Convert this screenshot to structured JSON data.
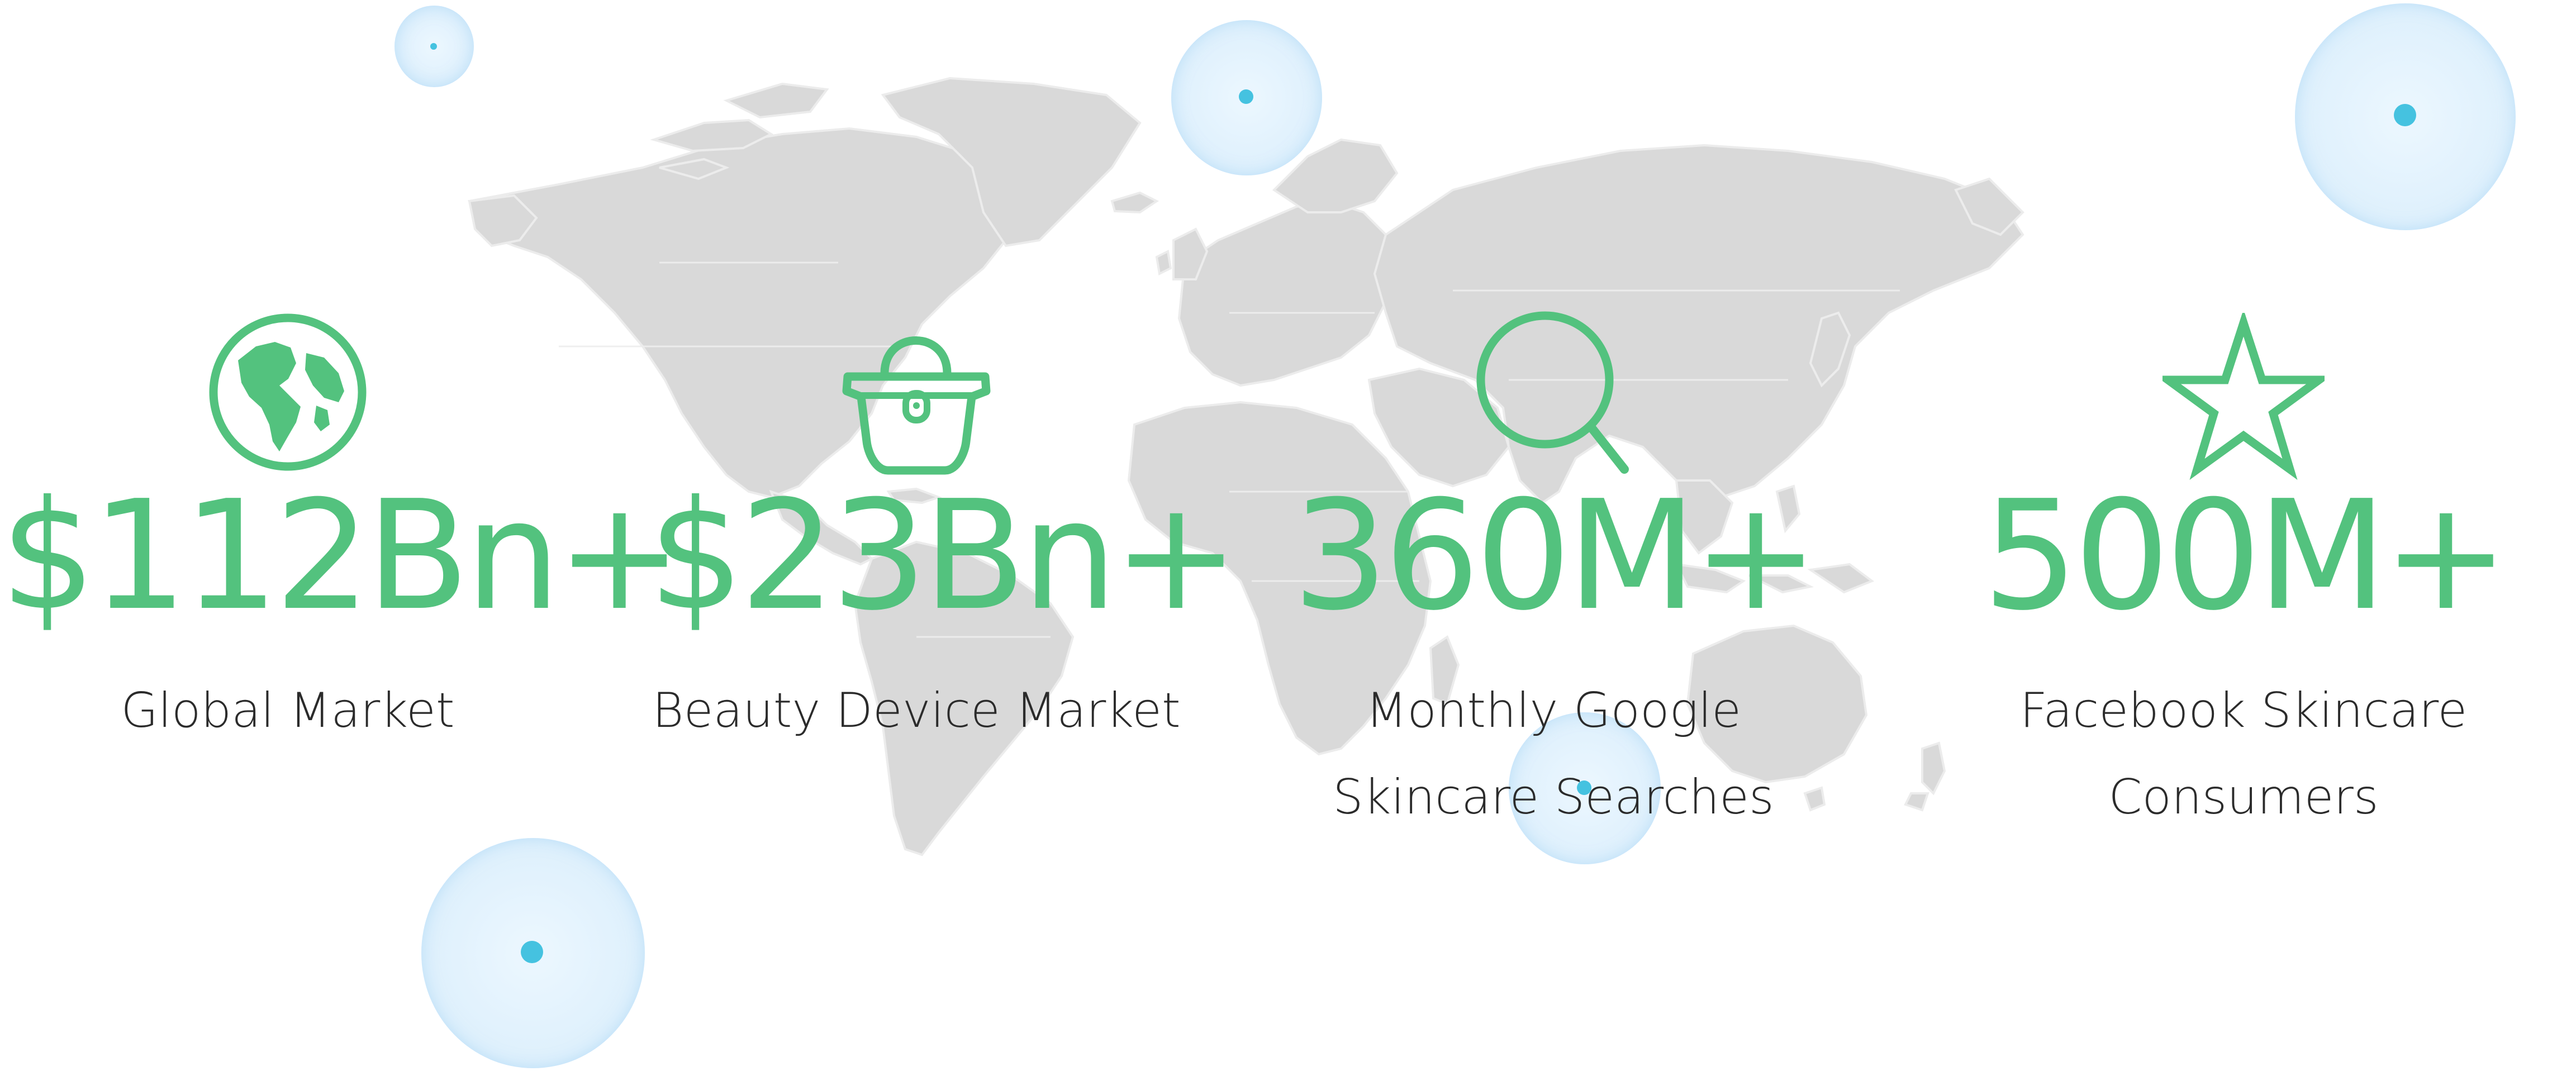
{
  "stats": [
    {
      "value": "$112Bn+",
      "label": "Global Market",
      "icon": "globe-icon"
    },
    {
      "value": "$23Bn+",
      "label": "Beauty Device Market",
      "icon": "handbag-icon"
    },
    {
      "value": "360M+",
      "label": "Monthly Google Skincare Searches",
      "icon": "magnifier-icon"
    },
    {
      "value": "500M+",
      "label": "Facebook Skincare Consumers",
      "icon": "star-icon"
    }
  ],
  "colors": {
    "accent": "#53c27e",
    "map": "#d9d9d9",
    "bubble_dot": "#45c2e0",
    "text": "#2b2b2b"
  }
}
